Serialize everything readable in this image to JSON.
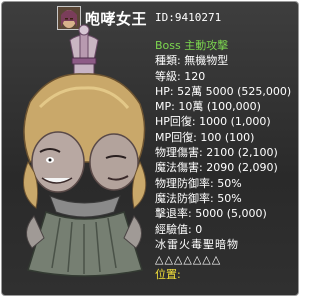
{
  "monster": {
    "name": "咆哮女王",
    "id_line": "ID:9410271"
  },
  "stats": {
    "boss_label": "Boss 主動攻擊",
    "lines": [
      "種類: 無機物型",
      "等級: 120",
      "HP: 52萬 5000 (525,000)",
      "MP: 10萬 (100,000)",
      "HP回復: 1000 (1,000)",
      "MP回復: 100 (100)",
      "物理傷害: 2100 (2,100)",
      "魔法傷害: 2090 (2,090)",
      "物理防御率: 50%",
      "魔法防御率: 50%",
      "擊退率: 5000 (5,000)",
      "經驗值: 0"
    ],
    "elements_label": "冰雷火毒聖暗物",
    "elements_marks": "△△△△△△△",
    "location_label": "位置:"
  }
}
